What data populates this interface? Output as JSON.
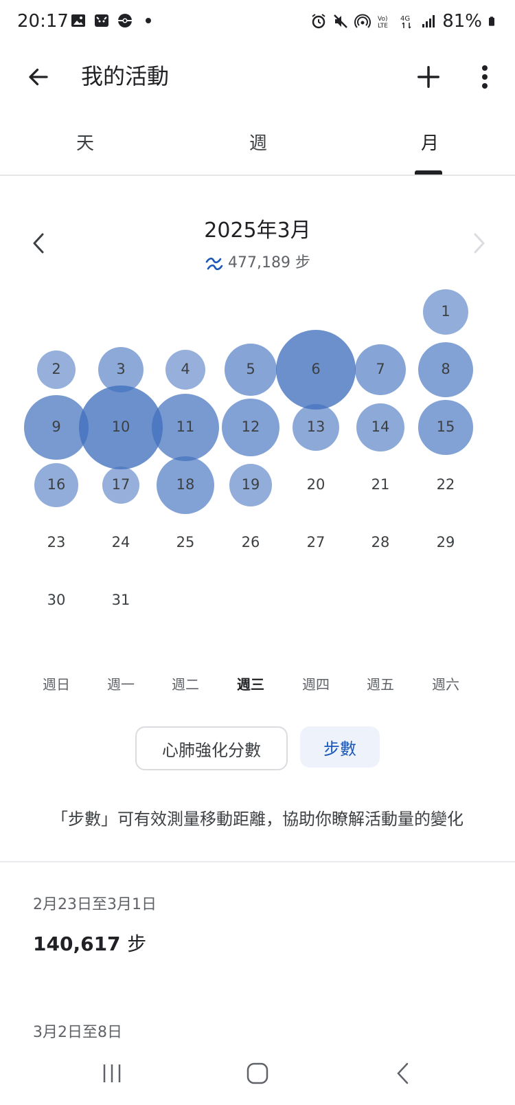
{
  "status_bar": {
    "time": "20:17",
    "battery": "81%"
  },
  "app_bar": {
    "title": "我的活動"
  },
  "tabs": [
    {
      "label": "天",
      "selected": false
    },
    {
      "label": "週",
      "selected": false
    },
    {
      "label": "月",
      "selected": true
    }
  ],
  "month": {
    "title": "2025年3月",
    "total_steps": "477,189 步"
  },
  "calendar": {
    "accent_color": "#3f6fbd",
    "days": [
      {
        "day": "1",
        "intensity": 0.45,
        "size": 0.76
      },
      {
        "day": "2",
        "intensity": 0.4,
        "size": 0.64
      },
      {
        "day": "3",
        "intensity": 0.5,
        "size": 0.76
      },
      {
        "day": "4",
        "intensity": 0.4,
        "size": 0.66
      },
      {
        "day": "5",
        "intensity": 0.55,
        "size": 0.86
      },
      {
        "day": "6",
        "intensity": 0.85,
        "size": 1.32
      },
      {
        "day": "7",
        "intensity": 0.55,
        "size": 0.84
      },
      {
        "day": "8",
        "intensity": 0.6,
        "size": 0.92
      },
      {
        "day": "9",
        "intensity": 0.7,
        "size": 1.06
      },
      {
        "day": "10",
        "intensity": 0.85,
        "size": 1.38
      },
      {
        "day": "11",
        "intensity": 0.7,
        "size": 1.12
      },
      {
        "day": "12",
        "intensity": 0.6,
        "size": 0.96
      },
      {
        "day": "13",
        "intensity": 0.5,
        "size": 0.78
      },
      {
        "day": "14",
        "intensity": 0.5,
        "size": 0.8
      },
      {
        "day": "15",
        "intensity": 0.6,
        "size": 0.9
      },
      {
        "day": "16",
        "intensity": 0.45,
        "size": 0.72
      },
      {
        "day": "17",
        "intensity": 0.4,
        "size": 0.62
      },
      {
        "day": "18",
        "intensity": 0.6,
        "size": 0.96
      },
      {
        "day": "19",
        "intensity": 0.45,
        "size": 0.7
      },
      {
        "day": "20",
        "intensity": 0,
        "size": 0
      },
      {
        "day": "21",
        "intensity": 0,
        "size": 0
      },
      {
        "day": "22",
        "intensity": 0,
        "size": 0
      },
      {
        "day": "23",
        "intensity": 0,
        "size": 0
      },
      {
        "day": "24",
        "intensity": 0,
        "size": 0
      },
      {
        "day": "25",
        "intensity": 0,
        "size": 0
      },
      {
        "day": "26",
        "intensity": 0,
        "size": 0
      },
      {
        "day": "27",
        "intensity": 0,
        "size": 0
      },
      {
        "day": "28",
        "intensity": 0,
        "size": 0
      },
      {
        "day": "29",
        "intensity": 0,
        "size": 0
      },
      {
        "day": "30",
        "intensity": 0,
        "size": 0
      },
      {
        "day": "31",
        "intensity": 0,
        "size": 0
      }
    ],
    "first_weekday": 6,
    "weekdays": [
      "週日",
      "週一",
      "週二",
      "週三",
      "週四",
      "週五",
      "週六"
    ],
    "today_weekday": 3
  },
  "metric_chips": {
    "cardio": "心肺強化分數",
    "steps": "步數",
    "selected": "steps"
  },
  "description": "「步數」可有效測量移動距離，協助你瞭解活動量的變化",
  "weekly": [
    {
      "range": "2月23日至3月1日",
      "total": "140,617",
      "unit": "步"
    },
    {
      "range": "3月2日至8日",
      "total": "",
      "unit": ""
    }
  ]
}
